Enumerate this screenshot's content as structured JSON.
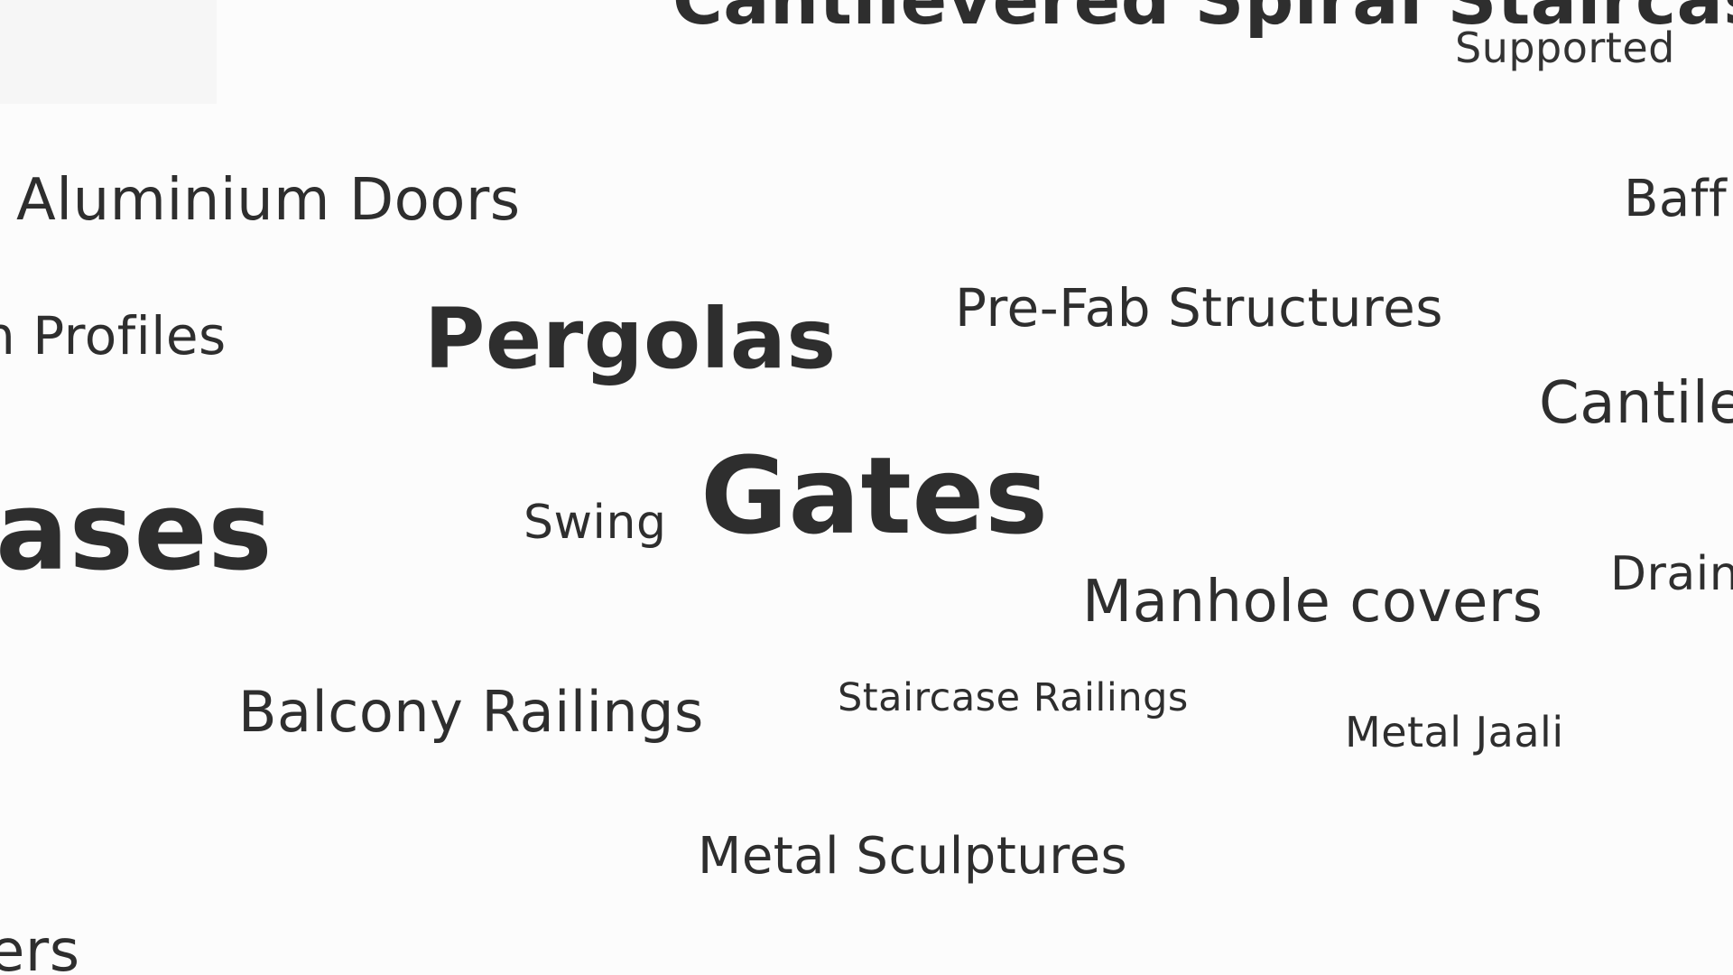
{
  "words": {
    "cantilevered_spiral": "Cantilevered Spiral Staircase",
    "supported": "Supported",
    "aluminium_doors": "Aluminium Doors",
    "baff": "Baff",
    "profiles": "n Profiles",
    "pergolas": "Pergolas",
    "prefab": "Pre-Fab Structures",
    "cantil": "Cantile",
    "ases": "ases",
    "swing": "Swing",
    "gates": "Gates",
    "manhole": "Manhole covers",
    "drain": "Drain",
    "balcony": "Balcony Railings",
    "staircase_railings": "Staircase Railings",
    "metal_jaali": "Metal Jaali",
    "metal_sculptures": "Metal Sculptures",
    "ers": "ers"
  },
  "colors": {
    "background": "#fcfcfc",
    "text": "#2e2e2e"
  }
}
